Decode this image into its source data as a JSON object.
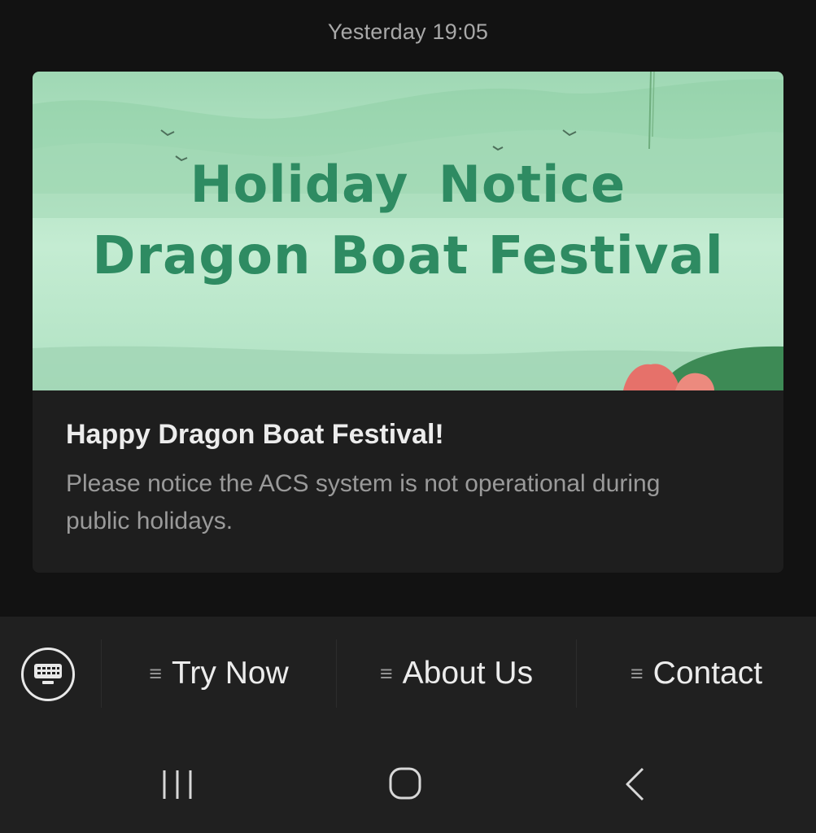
{
  "timestamp": "Yesterday 19:05",
  "card": {
    "banner": {
      "line1": "Holiday  Notice",
      "line2": "Dragon Boat Festival"
    },
    "title": "Happy Dragon Boat Festival!",
    "description": "Please notice the ACS system is not operational during public holidays."
  },
  "menu": {
    "keyboard_icon": "keyboard-icon",
    "items": [
      {
        "label": "Try Now",
        "icon": "menu-lines-icon"
      },
      {
        "label": "About Us",
        "icon": "menu-lines-icon"
      },
      {
        "label": "Contact",
        "icon": "menu-lines-icon"
      }
    ],
    "menu_glyph": "≡"
  },
  "nav": {
    "recent_icon": "recent-apps-icon",
    "home_icon": "home-icon",
    "back_icon": "back-icon"
  },
  "colors": {
    "background": "#121212",
    "card": "#1e1e1e",
    "banner_text": "#2e8b62",
    "banner_bg": "#b9e6c8",
    "bar": "#202020"
  }
}
